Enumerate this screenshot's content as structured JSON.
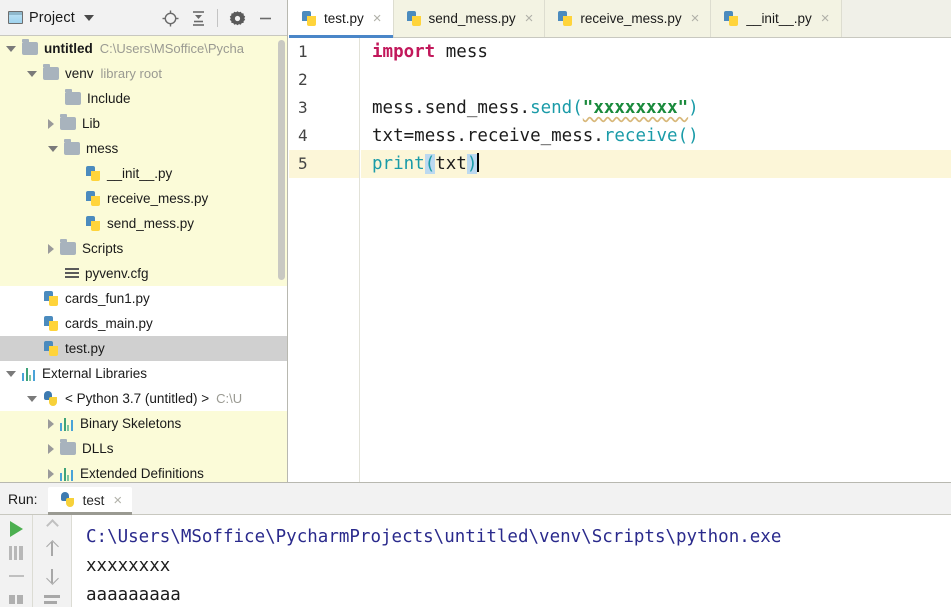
{
  "project_panel": {
    "title": "Project",
    "window_icon": "project-window-icon",
    "dropdown_icon": "chevron-down-icon",
    "toolbar_icons": [
      {
        "name": "locate-target-icon",
        "glyph": "target"
      },
      {
        "name": "collapse-all-icon",
        "glyph": "collapse"
      },
      {
        "name": "settings-gear-icon",
        "glyph": "gear"
      },
      {
        "name": "hide-panel-icon",
        "glyph": "minus"
      }
    ],
    "tree": [
      {
        "label": "untitled",
        "sub": "C:\\Users\\MSoffice\\Pycha",
        "indent": 0,
        "arrow": "open",
        "icon": "folder-icon",
        "bold": true,
        "bg": "highlight"
      },
      {
        "label": "venv",
        "sub": "library root",
        "indent": 1,
        "arrow": "open",
        "icon": "folder-icon",
        "bold": false,
        "bg": "highlight"
      },
      {
        "label": "Include",
        "sub": "",
        "indent": 2,
        "arrow": "none",
        "icon": "folder-icon",
        "bold": false,
        "bg": "highlight"
      },
      {
        "label": "Lib",
        "sub": "",
        "indent": 2,
        "arrow": "closed",
        "icon": "folder-icon",
        "bold": false,
        "bg": "highlight"
      },
      {
        "label": "mess",
        "sub": "",
        "indent": 2,
        "arrow": "open",
        "icon": "folder-icon",
        "bold": false,
        "bg": "highlight"
      },
      {
        "label": "__init__.py",
        "sub": "",
        "indent": 3,
        "arrow": "none",
        "icon": "python-file-icon",
        "bold": false,
        "bg": "highlight"
      },
      {
        "label": "receive_mess.py",
        "sub": "",
        "indent": 3,
        "arrow": "none",
        "icon": "python-file-icon",
        "bold": false,
        "bg": "highlight"
      },
      {
        "label": "send_mess.py",
        "sub": "",
        "indent": 3,
        "arrow": "none",
        "icon": "python-file-icon",
        "bold": false,
        "bg": "highlight"
      },
      {
        "label": "Scripts",
        "sub": "",
        "indent": 2,
        "arrow": "closed",
        "icon": "folder-icon",
        "bold": false,
        "bg": "highlight"
      },
      {
        "label": "pyvenv.cfg",
        "sub": "",
        "indent": 2,
        "arrow": "none",
        "icon": "config-file-icon",
        "bold": false,
        "bg": "highlight"
      },
      {
        "label": "cards_fun1.py",
        "sub": "",
        "indent": 1,
        "arrow": "none",
        "icon": "python-file-icon",
        "bold": false,
        "bg": "none"
      },
      {
        "label": "cards_main.py",
        "sub": "",
        "indent": 1,
        "arrow": "none",
        "icon": "python-file-icon",
        "bold": false,
        "bg": "none"
      },
      {
        "label": "test.py",
        "sub": "",
        "indent": 1,
        "arrow": "none",
        "icon": "python-file-icon",
        "bold": false,
        "bg": "selected"
      },
      {
        "label": "External Libraries",
        "sub": "",
        "indent": 0,
        "arrow": "open",
        "icon": "library-bars-icon",
        "bold": false,
        "bg": "none"
      },
      {
        "label": "< Python 3.7 (untitled) >",
        "sub": "C:\\U",
        "indent": 1,
        "arrow": "open",
        "icon": "python-logo-icon",
        "bold": false,
        "bg": "none"
      },
      {
        "label": "Binary Skeletons",
        "sub": "",
        "indent": 2,
        "arrow": "closed",
        "icon": "library-bars-icon",
        "bold": false,
        "bg": "highlight"
      },
      {
        "label": "DLLs",
        "sub": "",
        "indent": 2,
        "arrow": "closed",
        "icon": "folder-icon",
        "bold": false,
        "bg": "highlight"
      },
      {
        "label": "Extended Definitions",
        "sub": "",
        "indent": 2,
        "arrow": "closed",
        "icon": "library-bars-icon",
        "bold": false,
        "bg": "highlight"
      }
    ]
  },
  "editor": {
    "tabs": [
      {
        "label": "test.py",
        "active": true,
        "icon": "python-file-icon",
        "close": "×"
      },
      {
        "label": "send_mess.py",
        "active": false,
        "icon": "python-file-icon",
        "close": "×"
      },
      {
        "label": "receive_mess.py",
        "active": false,
        "icon": "python-file-icon",
        "close": "×"
      },
      {
        "label": "__init__.py",
        "active": false,
        "icon": "python-file-icon",
        "close": "×"
      }
    ],
    "line_numbers": [
      "1",
      "2",
      "3",
      "4",
      "5"
    ],
    "current_line": 5,
    "code_lines": [
      "import mess",
      "",
      "mess.send_mess.send(\"xxxxxxxx\")",
      "txt=mess.receive_mess.receive()",
      "print(txt)"
    ],
    "colors": {
      "keyword": "#c2185b",
      "function": "#1a9ba8",
      "string": "#1a8a3c",
      "paren_match_bg": "#bcd9f0",
      "current_line_bg": "#fcf6d8",
      "active_tab_underline": "#4a86c8"
    }
  },
  "run_panel": {
    "label": "Run:",
    "tab_label": "test",
    "tab_icon": "python-logo-icon",
    "tab_close": "×",
    "buttons": [
      {
        "name": "rerun-button",
        "glyph": "play"
      },
      {
        "name": "stop-button",
        "glyph": "stop"
      },
      {
        "name": "separator",
        "glyph": "minus"
      },
      {
        "name": "print-button",
        "glyph": "squares"
      },
      {
        "name": "scroll-up-button",
        "glyph": "arrow-up"
      },
      {
        "name": "scroll-down-button",
        "glyph": "arrow-down"
      },
      {
        "name": "soft-wrap-button",
        "glyph": "wrap"
      }
    ],
    "output": [
      {
        "text": "C:\\Users\\MSoffice\\PycharmProjects\\untitled\\venv\\Scripts\\python.exe",
        "kind": "path"
      },
      {
        "text": "xxxxxxxx",
        "kind": "plain"
      },
      {
        "text": "aaaaaaaaa",
        "kind": "plain"
      }
    ]
  }
}
